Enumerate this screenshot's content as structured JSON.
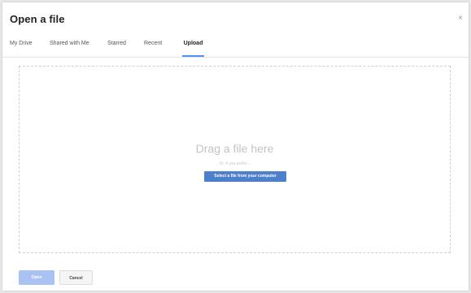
{
  "dialog": {
    "title": "Open a file",
    "close_glyph": "×"
  },
  "tabs": [
    {
      "label": "My Drive",
      "active": false
    },
    {
      "label": "Shared with Me",
      "active": false
    },
    {
      "label": "Starred",
      "active": false
    },
    {
      "label": "Recent",
      "active": false
    },
    {
      "label": "Upload",
      "active": true
    }
  ],
  "upload": {
    "heading": "Drag a file here",
    "subtext": "Or, if you prefer...",
    "select_button": "Select a file from your computer"
  },
  "footer": {
    "open_label": "Open",
    "cancel_label": "Cancel"
  },
  "colors": {
    "accent": "#4d7fcb",
    "active_tab_underline": "#4d90fe",
    "open_disabled": "#a9c2f2"
  }
}
